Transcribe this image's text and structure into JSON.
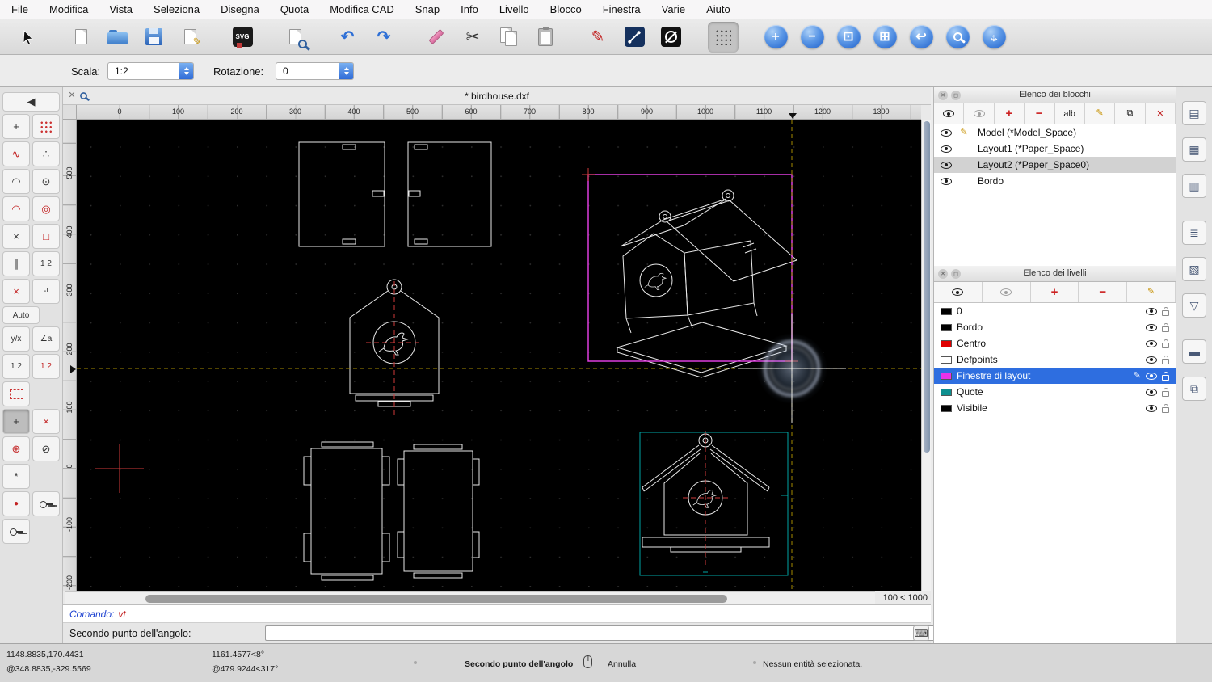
{
  "colors": {
    "accent_blue": "#2e6fd6",
    "canvas_bg": "#000000",
    "drawing_line": "#e9e9e9",
    "viewport_magenta": "#dd3ddd",
    "centerline_red": "#d03a3a",
    "crosshair_yellow": "#a38a00",
    "selection_cyan": "#00a5a5",
    "layer_selected_bg": "#2e6ee0"
  },
  "menu_bar": {
    "items": [
      "File",
      "Modifica",
      "Vista",
      "Seleziona",
      "Disegna",
      "Quota",
      "Modifica CAD",
      "Snap",
      "Info",
      "Livello",
      "Blocco",
      "Finestra",
      "Varie",
      "Aiuto"
    ]
  },
  "toolbar": {
    "svg_label": "SVG"
  },
  "options_bar": {
    "scale_label": "Scala:",
    "scale_value": "1:2",
    "rotation_label": "Rotazione:",
    "rotation_value": "0"
  },
  "drawing": {
    "title": "* birdhouse.dxf",
    "zoom_range": "100 < 1000",
    "top_ruler": [
      "0",
      "100",
      "200",
      "300",
      "400",
      "500",
      "600",
      "700",
      "800",
      "900",
      "1000",
      "1100",
      "1200",
      "1300"
    ],
    "left_ruler": [
      "500",
      "400",
      "300",
      "200",
      "100",
      "0",
      "-100",
      "-200"
    ]
  },
  "left_tools": {
    "auto_label": "Auto"
  },
  "blocks_panel": {
    "title": "Elenco dei blocchi",
    "toolbar": {
      "alb_label": "alb"
    },
    "items": [
      {
        "label": "Model (*Model_Space)"
      },
      {
        "label": "Layout1 (*Paper_Space)"
      },
      {
        "label": "Layout2 (*Paper_Space0)"
      },
      {
        "label": "Bordo"
      }
    ]
  },
  "layers_panel": {
    "title": "Elenco dei livelli",
    "items": [
      {
        "label": "0",
        "color": "#000000"
      },
      {
        "label": "Bordo",
        "color": "#000000"
      },
      {
        "label": "Centro",
        "color": "#e00000"
      },
      {
        "label": "Defpoints",
        "color": "#ffffff"
      },
      {
        "label": "Finestre di layout",
        "color": "#e832e8"
      },
      {
        "label": "Quote",
        "color": "#0e8f8f"
      },
      {
        "label": "Visibile",
        "color": "#000000"
      }
    ]
  },
  "command_area": {
    "prompt_label": "Comando:",
    "command_value": "vt",
    "input_label": "Secondo punto dell'angolo:",
    "input_value": ""
  },
  "status_bar": {
    "abs_coord": "1148.8835,170.4431",
    "rel_coord": "@348.8835,-329.5569",
    "abs_polar": "1161.4577<8°",
    "rel_polar": "@479.9244<317°",
    "prompt": "Secondo punto dell'angolo",
    "right_click_label": "Annulla",
    "selection_info": "Nessun entità selezionata."
  },
  "icons": {
    "undo": "↶",
    "redo": "↷",
    "cut": "✂",
    "pen": "✎",
    "pencil": "✎",
    "zoom_in": "+",
    "zoom_out": "−",
    "zoom_auto": "⊡",
    "zoom_window": "⊞",
    "previous_view": "↩",
    "pan_h": "↔",
    "pan_v": "↕",
    "back": "◀",
    "close": "✕",
    "float": "◻",
    "plus": "+",
    "minus": "−",
    "duplicate": "⧉",
    "delete": "✕",
    "keyboard": "⌨",
    "snap_wave": "∿",
    "snap_points": "∴",
    "arc": "◠",
    "center": "⊙",
    "reference": "◎",
    "cross": "×",
    "box": "□",
    "parallel": "∥",
    "ordinal": "1 2",
    "warn": "-!",
    "angle": "∠a",
    "yx": "y/x",
    "circle_plus": "⊕",
    "circle_slash": "⊘",
    "asterisk": "*",
    "dot": "●",
    "dock1": "▤",
    "dock2": "▦",
    "dock3": "▥",
    "dock4": "≣",
    "dock5": "▧",
    "dock6": "▽",
    "dock7": "▬",
    "dock8": "⧉"
  }
}
